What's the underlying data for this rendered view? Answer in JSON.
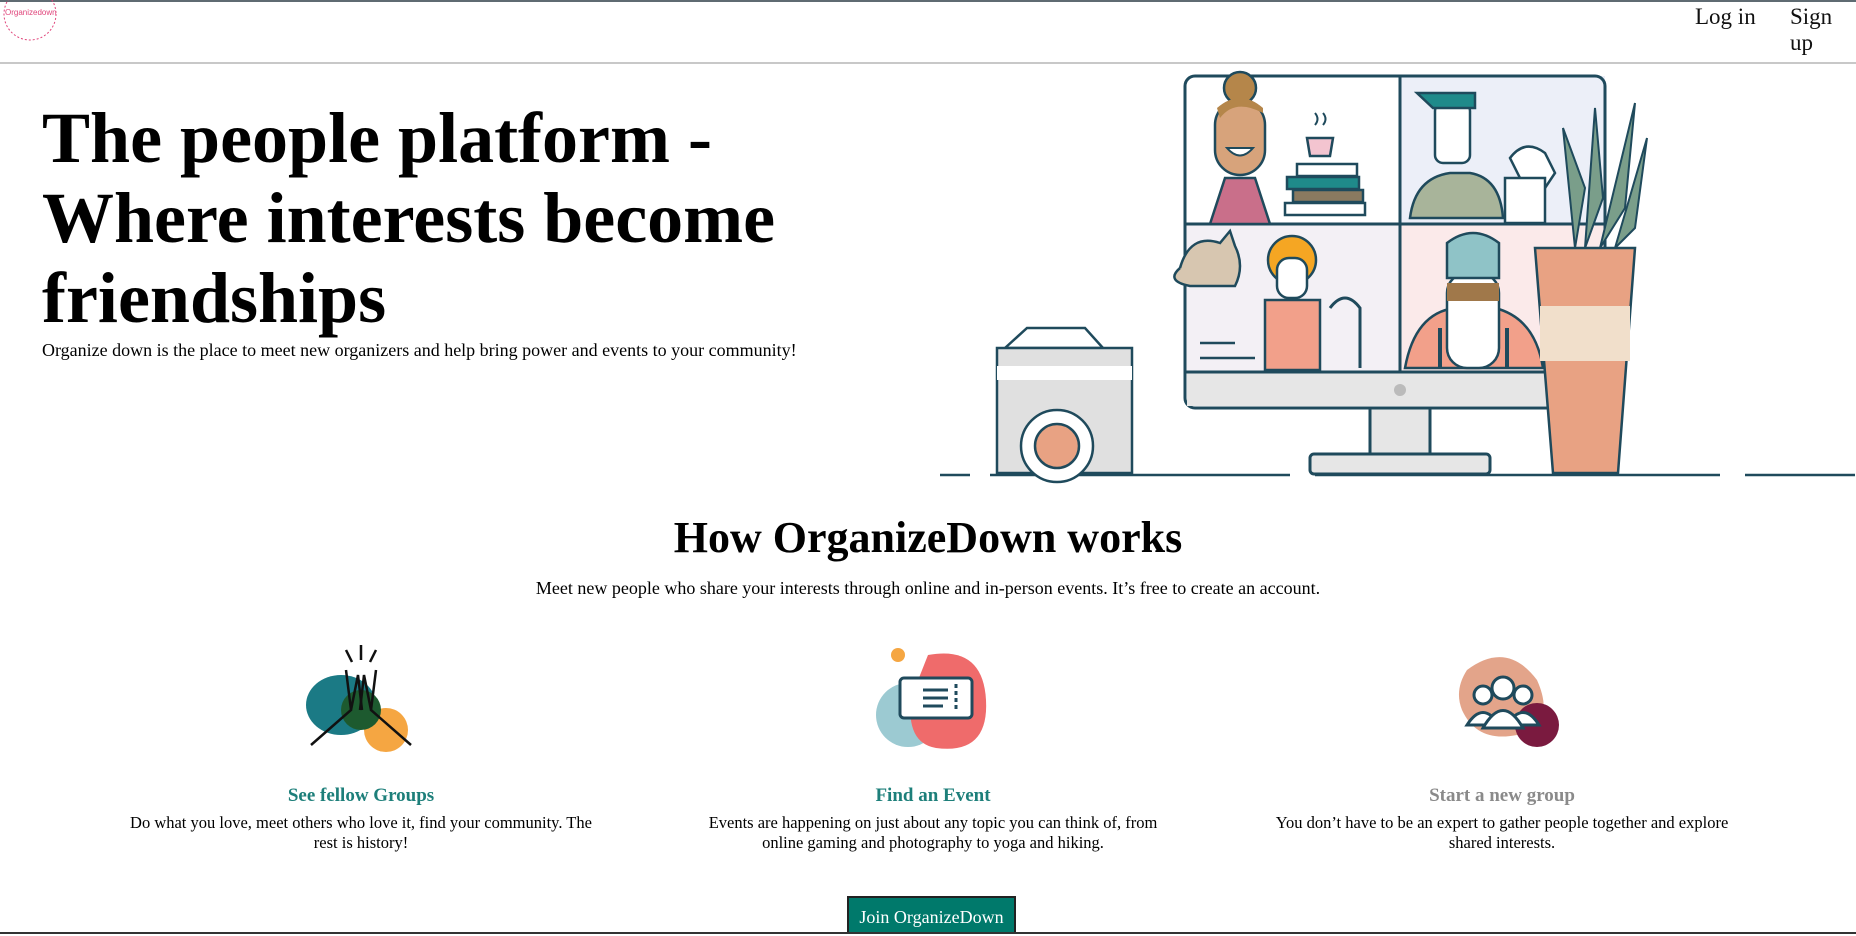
{
  "header": {
    "logo_text": "Organizedown",
    "login_label": "Log in",
    "signup_label": "Sign up"
  },
  "hero": {
    "title": "The people platform - Where interests become friendships",
    "subtitle": "Organize down is the place to meet new organizers and help bring power and events to your community!"
  },
  "how": {
    "title": "How OrganizeDown works",
    "subtitle": "Meet new people who share your interests through online and in-person events. It’s free to create an account."
  },
  "cards": [
    {
      "title": "See fellow Groups",
      "text": "Do what you love, meet others who love it, find your community. The rest is history!",
      "title_color": "#1d7f7a",
      "icon": "high-five-icon"
    },
    {
      "title": "Find an Event",
      "text": "Events are happening on just about any topic you can think of, from online gaming and photography to yoga and hiking.",
      "title_color": "#1d7f7a",
      "icon": "ticket-icon"
    },
    {
      "title": "Start a new group",
      "text": "You don’t have to be an expert to gather people together and explore shared interests.",
      "title_color": "#8a8a8a",
      "icon": "people-group-icon"
    }
  ],
  "cta": {
    "join_label": "Join OrganizeDown",
    "color": "#00796b"
  },
  "colors": {
    "accent": "#00796b",
    "logo": "#e0457b",
    "line": "#1f4a5c"
  }
}
